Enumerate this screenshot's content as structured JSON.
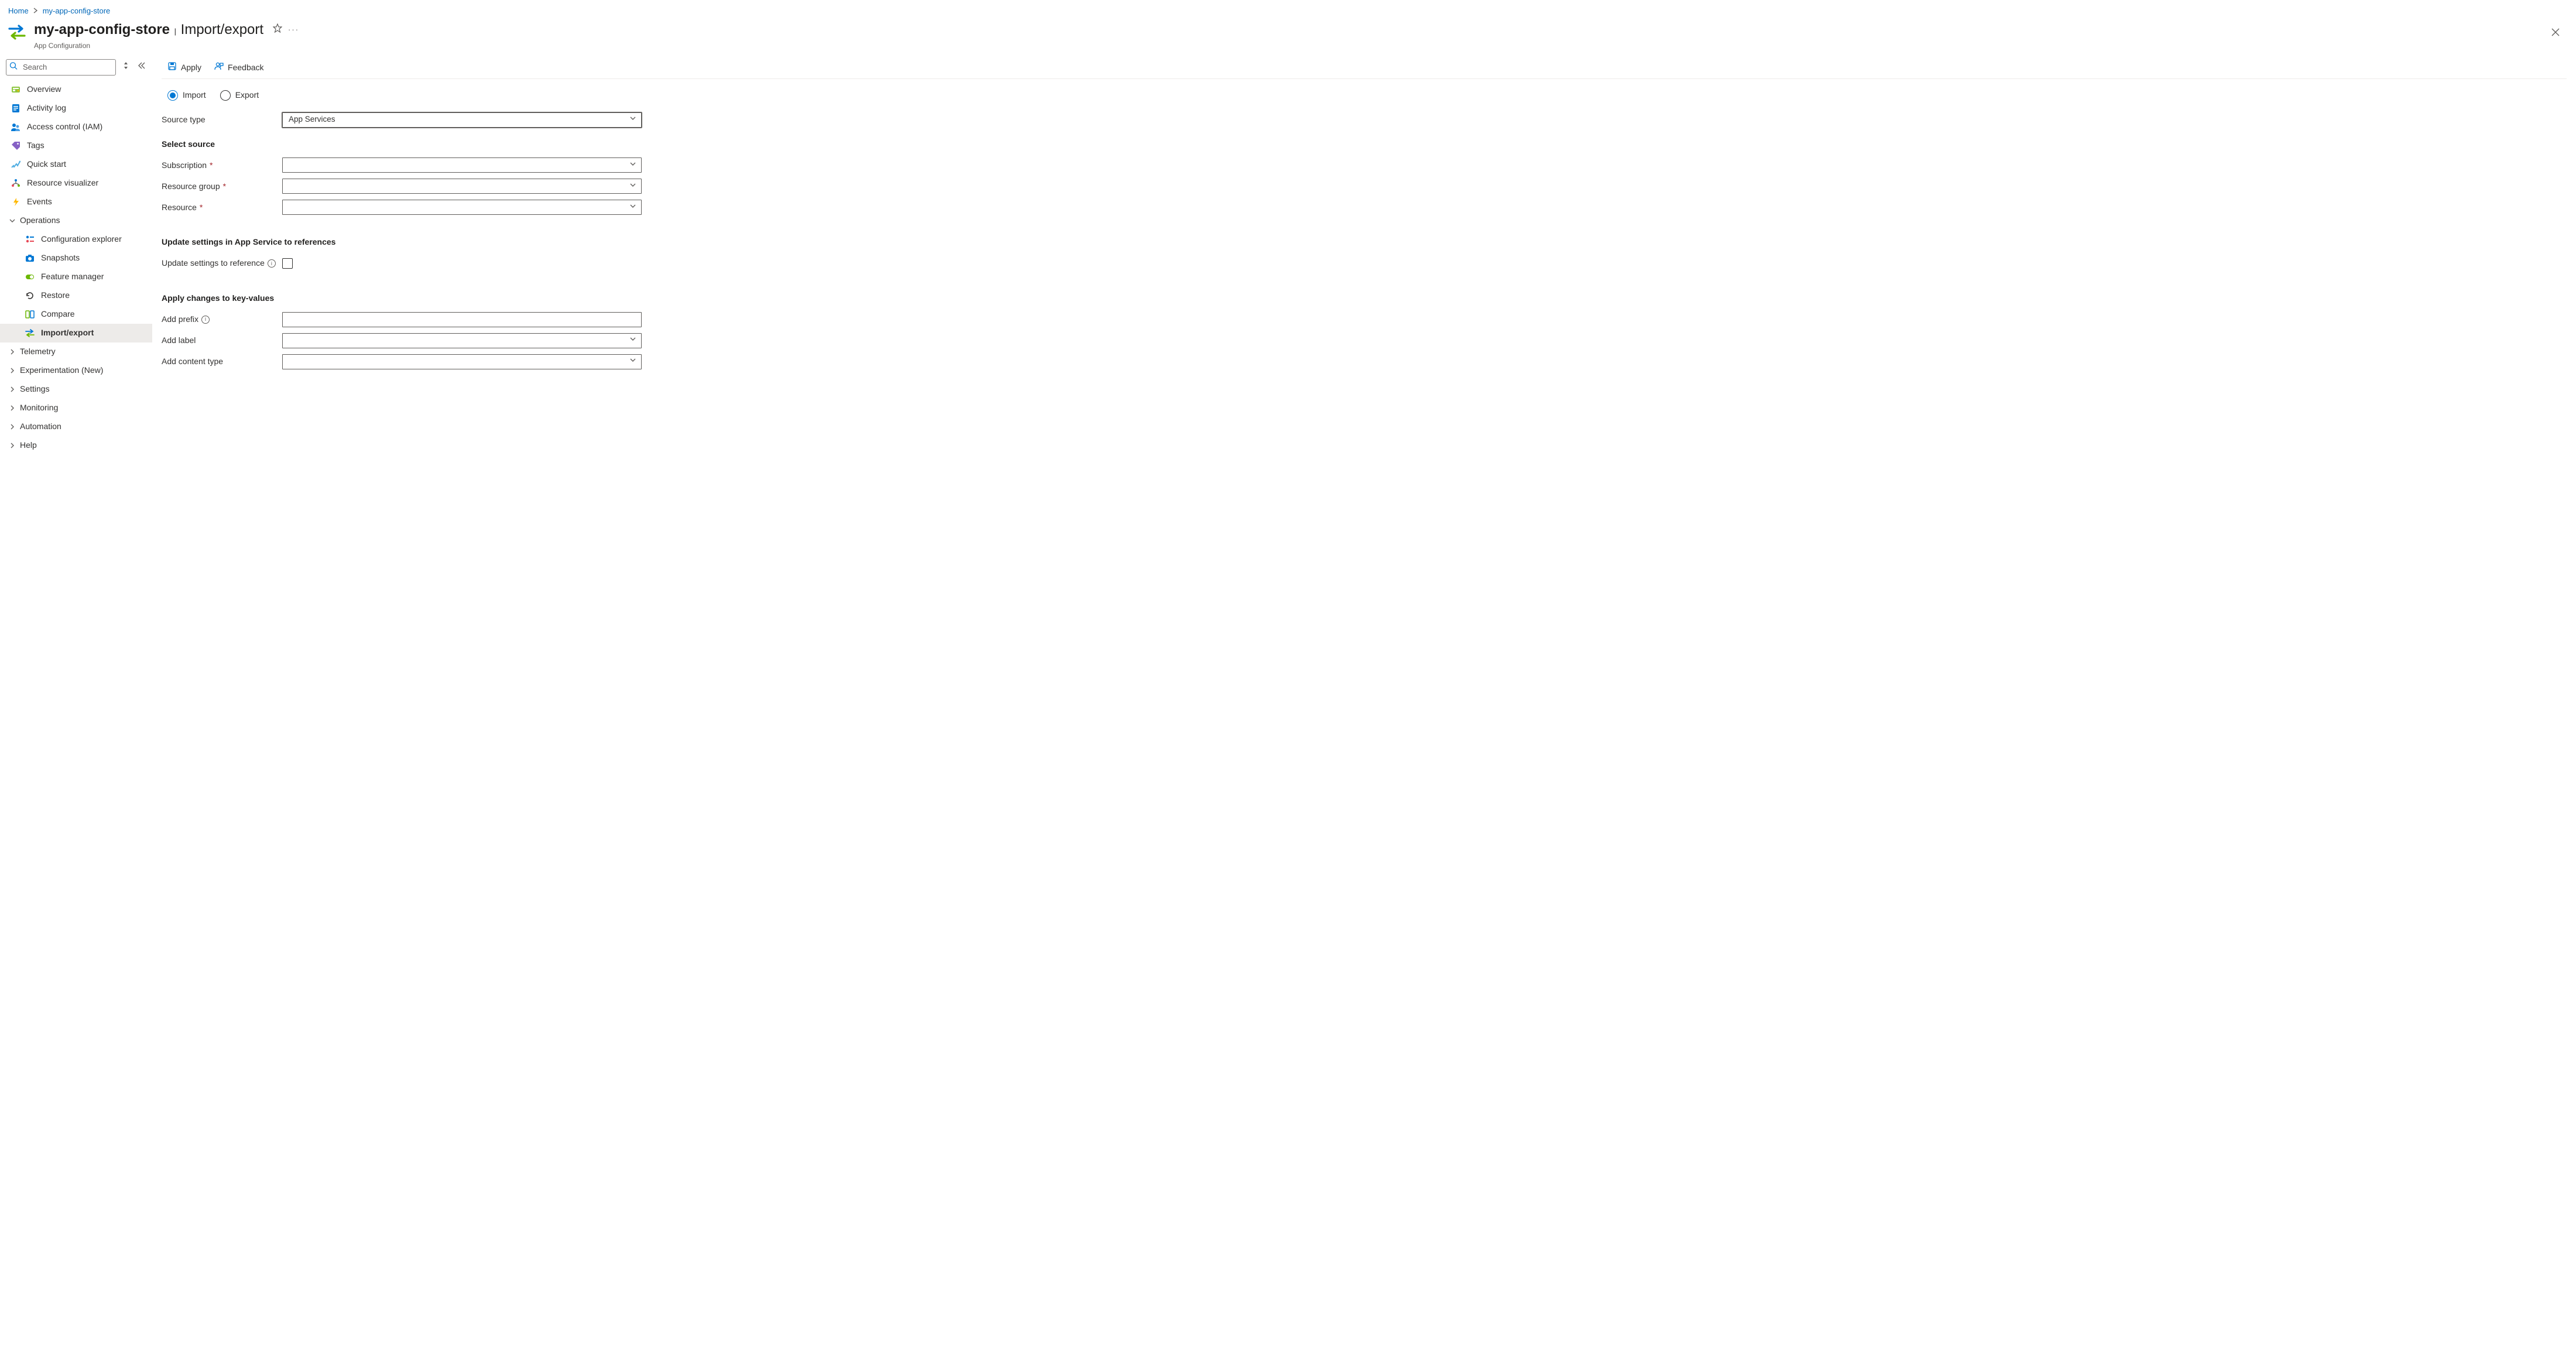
{
  "breadcrumb": {
    "home": "Home",
    "resource": "my-app-config-store"
  },
  "header": {
    "resource_name": "my-app-config-store",
    "separator": "|",
    "page": "Import/export",
    "subline": "App Configuration"
  },
  "sidebar": {
    "search_placeholder": "Search",
    "items": [
      {
        "label": "Overview",
        "kind": "item"
      },
      {
        "label": "Activity log",
        "kind": "item"
      },
      {
        "label": "Access control (IAM)",
        "kind": "item"
      },
      {
        "label": "Tags",
        "kind": "item"
      },
      {
        "label": "Quick start",
        "kind": "item"
      },
      {
        "label": "Resource visualizer",
        "kind": "item"
      },
      {
        "label": "Events",
        "kind": "item"
      },
      {
        "label": "Operations",
        "kind": "group",
        "expanded": true
      },
      {
        "label": "Configuration explorer",
        "kind": "child"
      },
      {
        "label": "Snapshots",
        "kind": "child"
      },
      {
        "label": "Feature manager",
        "kind": "child"
      },
      {
        "label": "Restore",
        "kind": "child"
      },
      {
        "label": "Compare",
        "kind": "child"
      },
      {
        "label": "Import/export",
        "kind": "child",
        "active": true
      },
      {
        "label": "Telemetry",
        "kind": "group"
      },
      {
        "label": "Experimentation (New)",
        "kind": "group"
      },
      {
        "label": "Settings",
        "kind": "group"
      },
      {
        "label": "Monitoring",
        "kind": "group"
      },
      {
        "label": "Automation",
        "kind": "group"
      },
      {
        "label": "Help",
        "kind": "group"
      }
    ]
  },
  "toolbar": {
    "apply": "Apply",
    "feedback": "Feedback"
  },
  "mode": {
    "import": "Import",
    "export": "Export",
    "selected": "import"
  },
  "form": {
    "source_type_label": "Source type",
    "source_type_value": "App Services",
    "select_source_heading": "Select source",
    "subscription_label": "Subscription",
    "resource_group_label": "Resource group",
    "resource_label": "Resource",
    "update_heading": "Update settings in App Service to references",
    "update_label": "Update settings to reference",
    "apply_heading": "Apply changes to key-values",
    "prefix_label": "Add prefix",
    "label_label": "Add label",
    "content_type_label": "Add content type"
  }
}
